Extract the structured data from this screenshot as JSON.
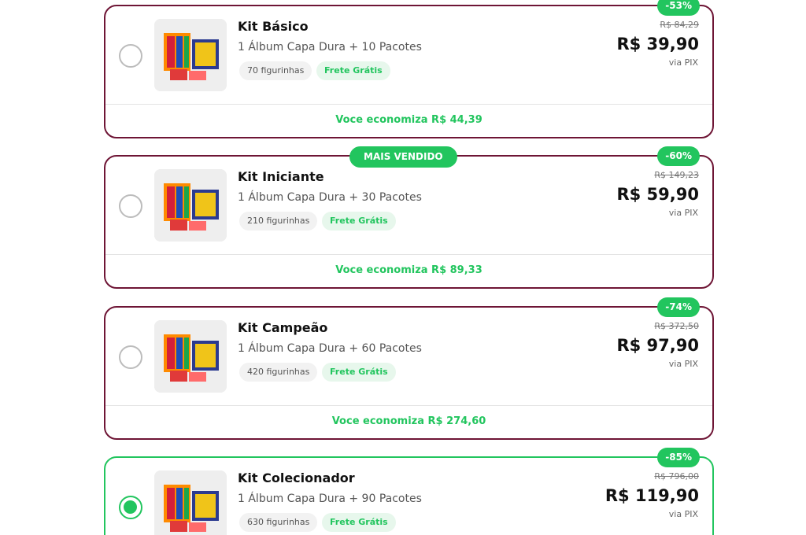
{
  "kits": [
    {
      "title": "Kit Básico",
      "description": "1 Álbum Capa Dura + 10 Pacotes",
      "stickers": "70 figurinhas",
      "shipping": "Frete Grátis",
      "discount": "-53%",
      "old_price": "R$ 84,29",
      "price": "R$ 39,90",
      "payment": "via PIX",
      "savings": "Voce economiza R$ 44,39",
      "selected": false
    },
    {
      "title": "Kit Iniciante",
      "description": "1 Álbum Capa Dura + 30 Pacotes",
      "stickers": "210 figurinhas",
      "shipping": "Frete Grátis",
      "discount": "-60%",
      "old_price": "R$ 149,23",
      "price": "R$ 59,90",
      "payment": "via PIX",
      "savings": "Voce economiza R$ 89,33",
      "badge": "MAIS VENDIDO",
      "selected": false
    },
    {
      "title": "Kit Campeão",
      "description": "1 Álbum Capa Dura + 60 Pacotes",
      "stickers": "420 figurinhas",
      "shipping": "Frete Grátis",
      "discount": "-74%",
      "old_price": "R$ 372,50",
      "price": "R$ 97,90",
      "payment": "via PIX",
      "savings": "Voce economiza R$ 274,60",
      "selected": false
    },
    {
      "title": "Kit Colecionador",
      "description": "1 Álbum Capa Dura + 90 Pacotes",
      "stickers": "630 figurinhas",
      "shipping": "Frete Grátis",
      "discount": "-85%",
      "old_price": "R$ 796,00",
      "price": "R$ 119,90",
      "payment": "via PIX",
      "selected": true
    }
  ],
  "colors": {
    "accent_green": "#22c55e",
    "card_border": "#6e1535",
    "selected_border": "#22c55e"
  },
  "icons": {
    "radio": "radio-button-icon",
    "product": "product-kit-image"
  }
}
